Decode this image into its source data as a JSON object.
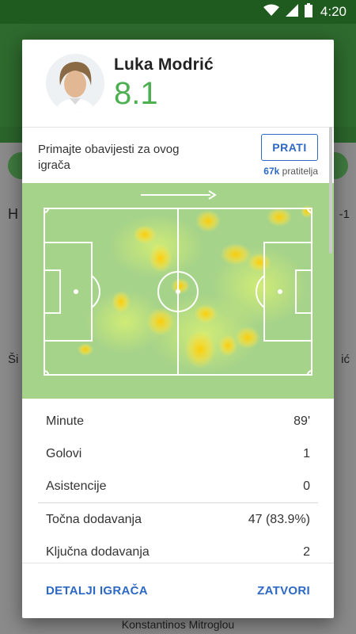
{
  "status": {
    "time": "4:20"
  },
  "background": {
    "right_score": "-1",
    "left_letter": "H",
    "row1_left": "Ši",
    "row1_right": "ić",
    "footer_player": "Konstantinos Mitroglou"
  },
  "player": {
    "name": "Luka Modrić",
    "rating": "8.1"
  },
  "follow": {
    "text": "Primajte obavijesti za ovog igrača",
    "button_label": "PRATI",
    "count": "67k",
    "count_label": "pratitelja"
  },
  "heatmap": {
    "direction": "attack-right"
  },
  "stats": [
    {
      "label": "Minute",
      "value": "89'"
    },
    {
      "label": "Golovi",
      "value": "1"
    },
    {
      "label": "Asistencije",
      "value": "0"
    },
    {
      "label": "Točna dodavanja",
      "value": "47 (83.9%)"
    },
    {
      "label": "Ključna dodavanja",
      "value": "2"
    }
  ],
  "actions": {
    "details_label": "DETALJI IGRAČA",
    "close_label": "ZATVORI"
  },
  "colors": {
    "accent": "#2d68c4",
    "rating": "#4caf50",
    "pitch": "#a6d38a"
  }
}
